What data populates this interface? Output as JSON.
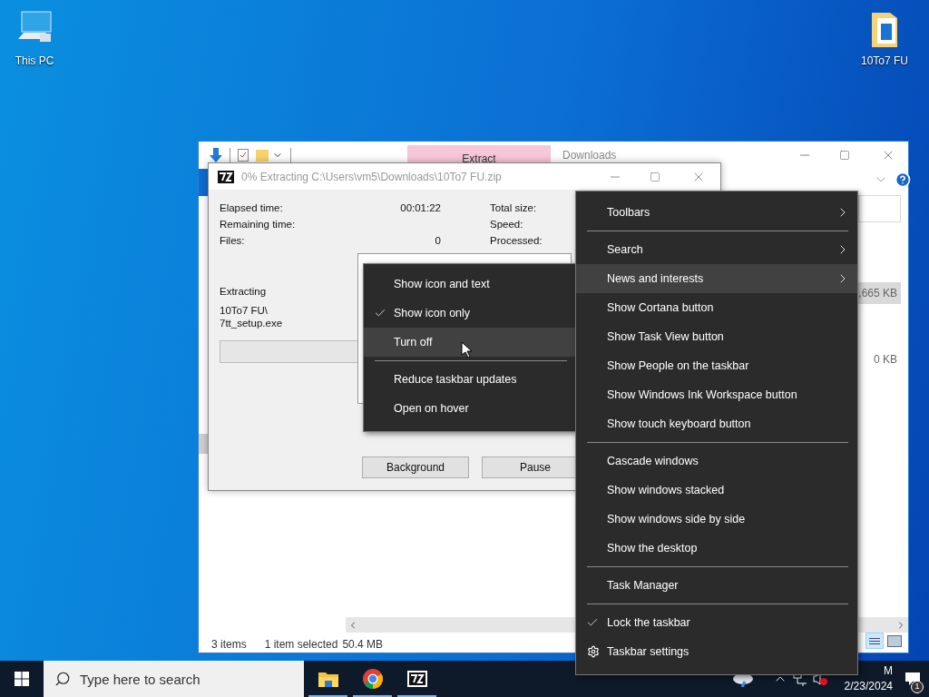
{
  "desktop_icons": [
    {
      "label": "This PC",
      "kind": "computer"
    },
    {
      "label": "10To7 FU",
      "kind": "folder"
    }
  ],
  "explorer": {
    "ribbon_tab": "Extract",
    "title": "Downloads",
    "cells": [
      {
        "text": ",665 KB",
        "selected": true
      },
      {
        "text": "0 KB",
        "selected": false
      }
    ],
    "status": [
      "3 items",
      "1 item selected",
      "50.4 MB"
    ]
  },
  "sevenzip": {
    "title": "0% Extracting C:\\Users\\vm5\\Downloads\\10To7 FU.zip",
    "stats": [
      {
        "label": "Elapsed time:",
        "value": "00:01:22"
      },
      {
        "label": "Remaining time:"
      },
      {
        "label": "Files:",
        "value": "0"
      }
    ],
    "right_stats": [
      "Total size:",
      "Speed:",
      "Processed:"
    ],
    "operation": "Extracting",
    "file_path": [
      "10To7 FU\\",
      "7tt_setup.exe"
    ],
    "progress": {
      "level": 0
    },
    "buttons": [
      "Background",
      "Pause"
    ]
  },
  "context_menu": {
    "items": [
      {
        "kind": "submenu",
        "label": "Toolbars",
        "selected": false
      },
      {
        "kind": "separator"
      },
      {
        "kind": "submenu",
        "label": "Search",
        "selected": false
      },
      {
        "kind": "submenu",
        "label": "News and interests",
        "selected": true
      },
      {
        "kind": "toggle",
        "label": "Show Cortana button",
        "checked": false,
        "selected": false
      },
      {
        "kind": "toggle",
        "label": "Show Task View button",
        "checked": false,
        "selected": false
      },
      {
        "kind": "toggle",
        "label": "Show People on the taskbar",
        "checked": false,
        "selected": false
      },
      {
        "kind": "toggle",
        "label": "Show Windows Ink Workspace button",
        "checked": false,
        "selected": false
      },
      {
        "kind": "toggle",
        "label": "Show touch keyboard button",
        "checked": false,
        "selected": false
      },
      {
        "kind": "separator"
      },
      {
        "kind": "command",
        "label": "Cascade windows",
        "selected": false
      },
      {
        "kind": "command",
        "label": "Show windows stacked",
        "selected": false
      },
      {
        "kind": "command",
        "label": "Show windows side by side",
        "selected": false
      },
      {
        "kind": "command",
        "label": "Show the desktop",
        "selected": false
      },
      {
        "kind": "separator"
      },
      {
        "kind": "command",
        "label": "Task Manager",
        "selected": false
      },
      {
        "kind": "separator"
      },
      {
        "kind": "toggle",
        "label": "Lock the taskbar",
        "checked": true,
        "selected": false
      },
      {
        "kind": "settings",
        "label": "Taskbar settings",
        "selected": false
      }
    ]
  },
  "submenu": {
    "items": [
      {
        "kind": "toggle",
        "label": "Show icon and text",
        "checked": false,
        "selected": false
      },
      {
        "kind": "toggle",
        "label": "Show icon only",
        "checked": true,
        "selected": false
      },
      {
        "kind": "command",
        "label": "Turn off",
        "selected": true
      },
      {
        "kind": "separator"
      },
      {
        "kind": "command",
        "label": "Reduce taskbar updates",
        "selected": false
      },
      {
        "kind": "command",
        "label": "Open on hover",
        "selected": false
      }
    ]
  },
  "taskbar": {
    "search": {
      "placeholder": "Type here to search"
    },
    "apps": [
      {
        "kind": "explorer",
        "running": true
      },
      {
        "kind": "chrome",
        "running": true
      },
      {
        "kind": "sevenzip",
        "running": true
      }
    ],
    "clock": {
      "time": "M",
      "date": "2/23/2024"
    },
    "notifications": "1"
  }
}
